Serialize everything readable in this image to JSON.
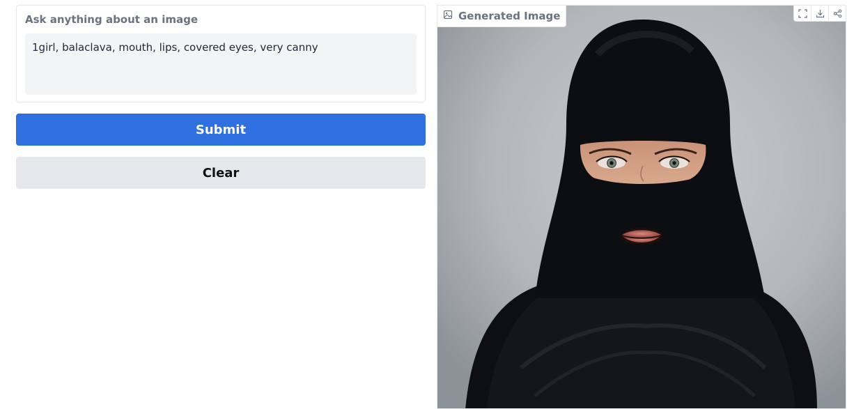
{
  "prompt": {
    "label": "Ask anything about an image",
    "value": "1girl, balaclava, mouth, lips, covered eyes, very canny"
  },
  "buttons": {
    "submit_label": "Submit",
    "clear_label": "Clear"
  },
  "output": {
    "label": "Generated Image",
    "label_icon": "image-icon",
    "toolbar_icons": [
      "fullscreen-icon",
      "download-icon",
      "share-icon"
    ]
  },
  "colors": {
    "submit_bg": "#2f6fe0",
    "clear_bg": "#e5e7eb",
    "label_text": "#6b7280"
  }
}
